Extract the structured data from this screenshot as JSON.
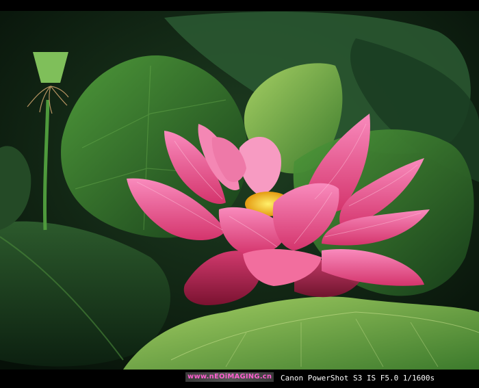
{
  "photo": {
    "subject": "pink lotus flower among green lotus leaves",
    "colors": {
      "background": "#0b1a10",
      "leaf_dark": "#163a1a",
      "leaf_mid": "#2f6a2a",
      "leaf_light": "#7fb04a",
      "petal_pink": "#f07aa8",
      "petal_deep": "#d8356f",
      "stamen_yellow": "#f5c21a"
    }
  },
  "caption": {
    "watermark": "www.nEOiMAGING.cn",
    "camera": "Canon PowerShot S3 IS F5.0 1/1600s"
  }
}
